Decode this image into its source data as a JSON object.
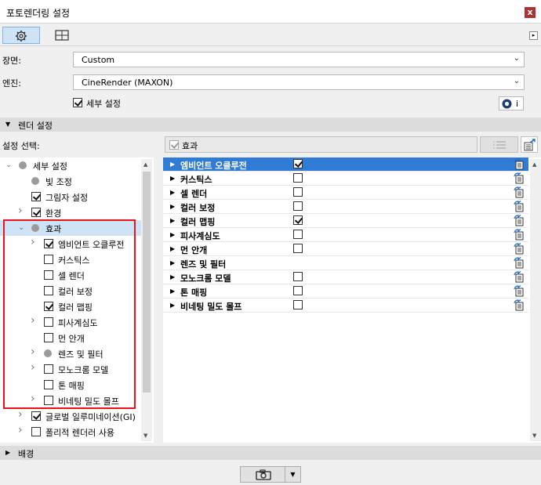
{
  "window": {
    "title": "포토렌더링 설정",
    "close_label": "x"
  },
  "toolbar": {
    "expand_label": "▸"
  },
  "form": {
    "scene_label": "장면:",
    "scene_value": "Custom",
    "engine_label": "엔진:",
    "engine_value": "CineRender (MAXON)",
    "detail_settings_label": "세부 설정",
    "detail_settings_checked": true,
    "info_label": "i"
  },
  "render_settings": {
    "header": "렌더 설정",
    "select_label": "설정 선택:",
    "current_selection": "효과"
  },
  "tree": [
    {
      "label": "세부 설정",
      "indent": 0,
      "expander": "down",
      "kind": "dot",
      "checked": false
    },
    {
      "label": "빛 조정",
      "indent": 1,
      "expander": "",
      "kind": "dot",
      "checked": false
    },
    {
      "label": "그림자 설정",
      "indent": 1,
      "expander": "",
      "kind": "check",
      "checked": true
    },
    {
      "label": "환경",
      "indent": 1,
      "expander": "right",
      "kind": "check",
      "checked": true
    },
    {
      "label": "효과",
      "indent": 1,
      "expander": "down",
      "kind": "dot",
      "checked": false,
      "selected": true
    },
    {
      "label": "엠비언트 오클루전",
      "indent": 2,
      "expander": "right",
      "kind": "check",
      "checked": true
    },
    {
      "label": "커스틱스",
      "indent": 2,
      "expander": "",
      "kind": "check",
      "checked": false
    },
    {
      "label": "셀 렌더",
      "indent": 2,
      "expander": "",
      "kind": "check",
      "checked": false
    },
    {
      "label": "컬러 보정",
      "indent": 2,
      "expander": "",
      "kind": "check",
      "checked": false
    },
    {
      "label": "컬러 맵핑",
      "indent": 2,
      "expander": "",
      "kind": "check",
      "checked": true
    },
    {
      "label": "피사계심도",
      "indent": 2,
      "expander": "right",
      "kind": "check",
      "checked": false
    },
    {
      "label": "먼 안개",
      "indent": 2,
      "expander": "",
      "kind": "check",
      "checked": false
    },
    {
      "label": "렌즈 및 필터",
      "indent": 2,
      "expander": "right",
      "kind": "dot",
      "checked": false
    },
    {
      "label": "모노크롬 모델",
      "indent": 2,
      "expander": "right",
      "kind": "check",
      "checked": false
    },
    {
      "label": "톤 매핑",
      "indent": 2,
      "expander": "",
      "kind": "check",
      "checked": false
    },
    {
      "label": "비네팅 밀도 몰프",
      "indent": 2,
      "expander": "right",
      "kind": "check",
      "checked": false
    },
    {
      "label": "글로벌 일루미네이션(GI)",
      "indent": 1,
      "expander": "right",
      "kind": "check",
      "checked": true
    },
    {
      "label": "폴리적 렌더러 사용",
      "indent": 1,
      "expander": "right",
      "kind": "check",
      "checked": false
    }
  ],
  "effects": [
    {
      "label": "엠비언트 오클루전",
      "checked": true,
      "has_check": true,
      "selected": true
    },
    {
      "label": "커스틱스",
      "checked": false,
      "has_check": true
    },
    {
      "label": "셀 렌더",
      "checked": false,
      "has_check": true
    },
    {
      "label": "컬러 보정",
      "checked": false,
      "has_check": true
    },
    {
      "label": "컬러 맵핑",
      "checked": true,
      "has_check": true
    },
    {
      "label": "피사계심도",
      "checked": false,
      "has_check": true
    },
    {
      "label": "먼 안개",
      "checked": false,
      "has_check": true
    },
    {
      "label": "렌즈 및 필터",
      "checked": false,
      "has_check": false
    },
    {
      "label": "모노크롬 모델",
      "checked": false,
      "has_check": true
    },
    {
      "label": "톤 매핑",
      "checked": false,
      "has_check": true
    },
    {
      "label": "비네팅 밀도 몰프",
      "checked": false,
      "has_check": true
    }
  ],
  "background_section": {
    "header": "배경"
  },
  "colors": {
    "selection": "#2f7bd6",
    "tree_selection": "#cfe3f7",
    "highlight_box": "#e8141c"
  },
  "icons": [
    "settings-gear-icon",
    "layout-grid-icon",
    "cinema4d-icon",
    "list-options-icon",
    "export-icon",
    "copy-settings-icon",
    "camera-icon"
  ]
}
